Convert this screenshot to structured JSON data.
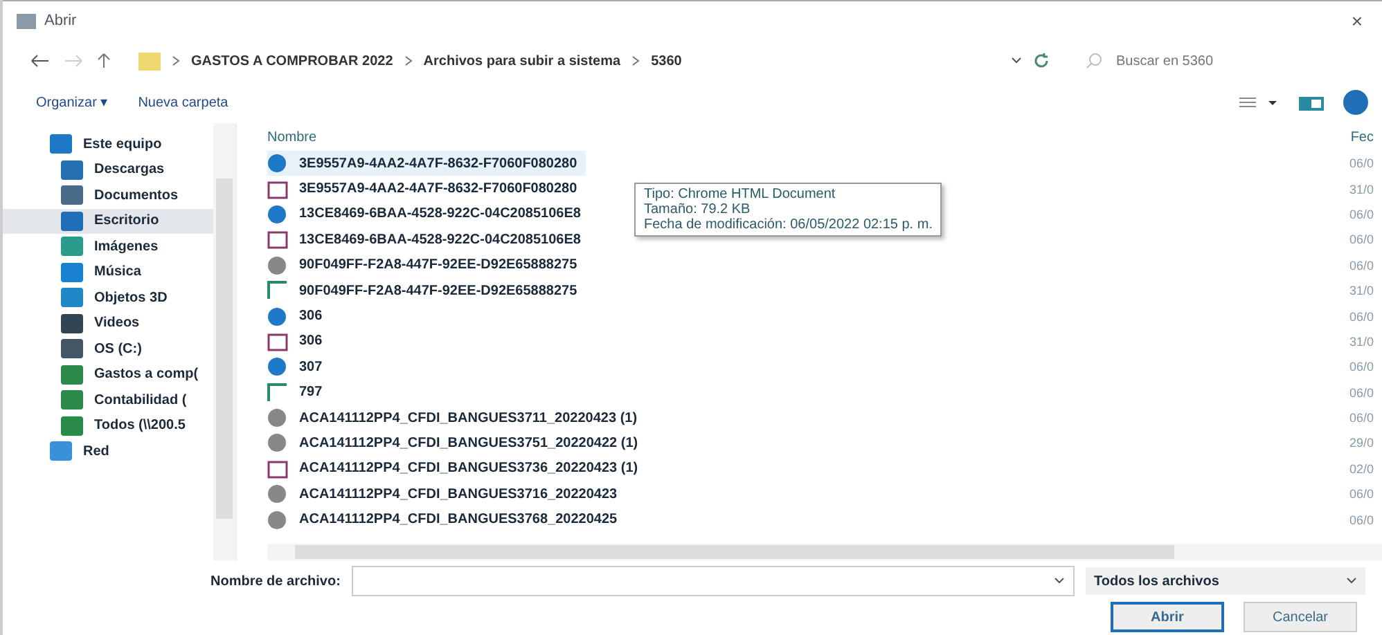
{
  "window": {
    "title": "Abrir",
    "close": "×"
  },
  "address": {
    "path": [
      {
        "label": "GASTOS A COMPROBAR 2022"
      },
      {
        "label": "Archivos para subir a sistema"
      },
      {
        "label": "5360"
      }
    ],
    "search_placeholder": "Buscar en 5360"
  },
  "toolbar": {
    "organize": "Organizar ▾",
    "new_folder": "Nueva carpeta"
  },
  "sidebar": {
    "items": [
      {
        "label": "Este equipo",
        "kind": "pc",
        "selected": false,
        "children": [
          {
            "label": "Descargas",
            "kind": "download",
            "selected": false
          },
          {
            "label": "Documentos",
            "kind": "docs",
            "selected": false
          },
          {
            "label": "Escritorio",
            "kind": "desktop",
            "selected": true
          },
          {
            "label": "Imágenes",
            "kind": "images",
            "selected": false
          },
          {
            "label": "Música",
            "kind": "music",
            "selected": false
          },
          {
            "label": "Objetos 3D",
            "kind": "objects",
            "selected": false
          },
          {
            "label": "Videos",
            "kind": "video",
            "selected": false
          },
          {
            "label": "OS (C:)",
            "kind": "drive",
            "selected": false
          },
          {
            "label": "Gastos a comp(",
            "kind": "netdrive",
            "selected": false
          },
          {
            "label": "Contabilidad (",
            "kind": "netdrive",
            "selected": false
          },
          {
            "label": "Todos (\\\\200.5",
            "kind": "netdrive",
            "selected": false
          }
        ]
      },
      {
        "label": "Red",
        "kind": "network",
        "selected": false
      }
    ]
  },
  "table": {
    "columns": [
      "Nombre",
      "Fec"
    ],
    "rows": [
      {
        "name": "3E9557A9-4AA2-4A7F-8632-F7060F080280",
        "kind": "chrome",
        "date": "06/0",
        "selected": true
      },
      {
        "name": "3E9557A9-4AA2-4A7F-8632-F7060F080280",
        "kind": "html",
        "date": "31/0",
        "selected": false
      },
      {
        "name": "13CE8469-6BAA-4528-922C-04C2085106E8",
        "kind": "chrome",
        "date": "06/0",
        "selected": false
      },
      {
        "name": "13CE8469-6BAA-4528-922C-04C2085106E8",
        "kind": "html",
        "date": "06/0",
        "selected": false
      },
      {
        "name": "90F049FF-F2A8-447F-92EE-D92E65888275",
        "kind": "pdf",
        "date": "06/0",
        "selected": false
      },
      {
        "name": "90F049FF-F2A8-447F-92EE-D92E65888275",
        "kind": "xml",
        "date": "31/0",
        "selected": false
      },
      {
        "name": "306",
        "kind": "chrome",
        "date": "06/0",
        "selected": false
      },
      {
        "name": "306",
        "kind": "html",
        "date": "31/0",
        "selected": false
      },
      {
        "name": "307",
        "kind": "chrome",
        "date": "06/0",
        "selected": false
      },
      {
        "name": "797",
        "kind": "xml",
        "date": "06/0",
        "selected": false
      },
      {
        "name": "ACA141112PP4_CFDI_BANGUES3711_20220423 (1)",
        "kind": "pdf",
        "date": "06/0",
        "selected": false
      },
      {
        "name": "ACA141112PP4_CFDI_BANGUES3751_20220422 (1)",
        "kind": "pdf",
        "date": "29/0",
        "selected": false
      },
      {
        "name": "ACA141112PP4_CFDI_BANGUES3736_20220423 (1)",
        "kind": "html",
        "date": "02/0",
        "selected": false
      },
      {
        "name": "ACA141112PP4_CFDI_BANGUES3716_20220423",
        "kind": "pdf",
        "date": "06/0",
        "selected": false
      },
      {
        "name": "ACA141112PP4_CFDI_BANGUES3768_20220425",
        "kind": "pdf",
        "date": "06/0",
        "selected": false
      }
    ]
  },
  "tooltip": {
    "lines": [
      "Tipo: Chrome HTML Document",
      "Tamaño: 79.2 KB",
      "Fecha de modificación: 06/05/2022 02:15 p. m."
    ]
  },
  "footer": {
    "filename_label": "Nombre de archivo:",
    "filter": "Todos los archivos",
    "open": "Abrir",
    "cancel": "Cancelar"
  }
}
